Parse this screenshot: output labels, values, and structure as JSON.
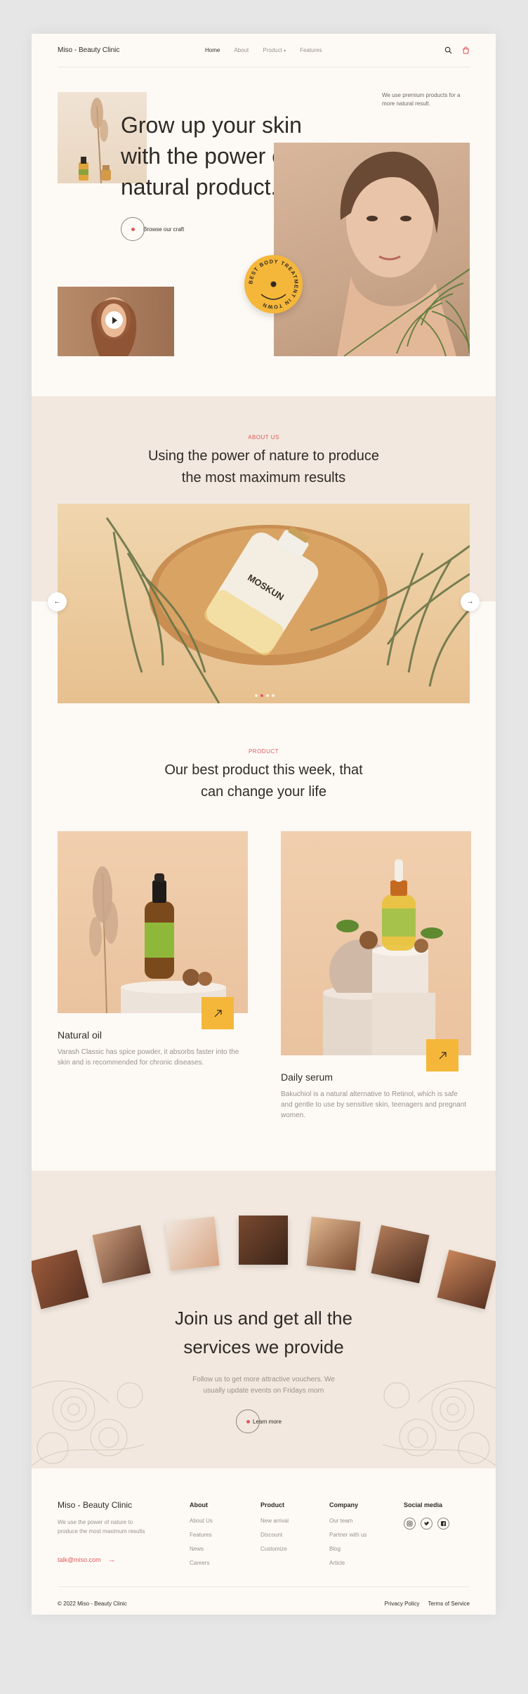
{
  "nav": {
    "brand": "Miso - Beauty Clinic",
    "items": [
      "Home",
      "About",
      "Product",
      "Features"
    ],
    "icons": [
      "search-icon",
      "bag-icon"
    ]
  },
  "hero": {
    "title_lines": [
      "Grow up your skin",
      "with the power of",
      "natural product."
    ],
    "note": "We use premium products for a more natural result.",
    "browse_label": "Browse our craft",
    "badge_text": "BEST BODY TREATMENT IN TOWN"
  },
  "about": {
    "eyebrow": "ABOUT US",
    "title_lines": [
      "Using the power of nature to produce",
      "the most maximum results"
    ],
    "bottle_label": "MOSKUN",
    "slides_total": 4,
    "slide_active": 1
  },
  "products": {
    "eyebrow": "PRODUCT",
    "title_lines": [
      "Our best product this week, that",
      "can change your life"
    ],
    "items": [
      {
        "name": "Natural oil",
        "desc": "Varash Classic has spice powder, it absorbs faster into the skin and is recommended for chronic diseases."
      },
      {
        "name": "Daily serum",
        "desc": "Bakuchiol is a natural alternative to Retinol, which is safe and gentle to use by sensitive skin, teenagers and pregnant women."
      }
    ]
  },
  "join": {
    "title_lines": [
      "Join us and get all the",
      "services we provide"
    ],
    "sub_lines": [
      "Follow us to get more attractive vouchers. We",
      "usually update events on Fridays morn"
    ],
    "learn_label": "Learn more"
  },
  "footer": {
    "brand": "Miso - Beauty Clinic",
    "desc": "We use the power of nature to produce the most maximum results",
    "email": "talk@miso.com",
    "columns": [
      {
        "title": "About",
        "links": [
          "About Us",
          "Features",
          "News",
          "Careers"
        ]
      },
      {
        "title": "Product",
        "links": [
          "New arrival",
          "Discount",
          "Customize"
        ]
      },
      {
        "title": "Company",
        "links": [
          "Our team",
          "Partner with us",
          "Blog",
          "Article"
        ]
      }
    ],
    "social_title": "Social media",
    "social_icons": [
      "instagram-icon",
      "twitter-icon",
      "facebook-icon"
    ],
    "copyright": "© 2022 Miso - Beauty Clinic",
    "privacy": "Privacy Policy",
    "terms": "Terms of Service"
  },
  "colors": {
    "accent": "#e05a5a",
    "yellow": "#f5b73a",
    "cream": "#fdfaf6",
    "beige": "#f2e8df",
    "text": "#2f2a26",
    "muted": "#9a918a"
  }
}
